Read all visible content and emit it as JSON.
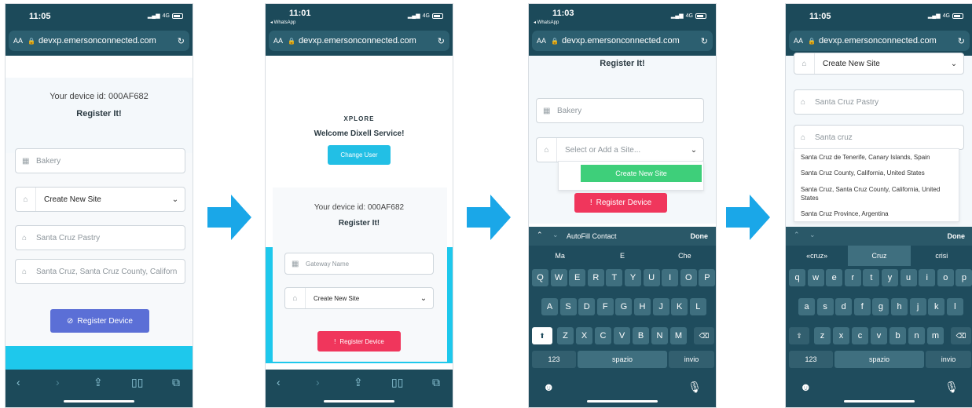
{
  "arrow_color": "#1aa7e8",
  "phones": [
    {
      "status_time": "11:05",
      "status_back": "",
      "signal": "4G",
      "url_aa": "AA",
      "url": "devxp.emersonconnected.com",
      "device_id": "Your device id: 000AF682",
      "register_it": "Register It!",
      "gateway_value": "Bakery",
      "site_select": "Create New Site",
      "site_name_value": "Santa Cruz Pastry",
      "address_value": "Santa Cruz, Santa Cruz County, Californ",
      "register_button": "Register Device",
      "register_color": "#5b6fd6"
    },
    {
      "status_time": "11:01",
      "status_back": "◂ WhatsApp",
      "signal": "4G",
      "url_aa": "AA",
      "url": "devxp.emersonconnected.com",
      "brand": "XPLORE",
      "welcome": "Welcome Dixell Service!",
      "change_user": "Change User",
      "device_id": "Your device id: 000AF682",
      "register_it": "Register It!",
      "gateway_placeholder": "Gateway Name",
      "site_select": "Create New Site",
      "register_button": "Register Device",
      "register_color": "#f0365c"
    },
    {
      "status_time": "11:03",
      "status_back": "◂ WhatsApp",
      "signal": "4G",
      "url_aa": "AA",
      "url": "devxp.emersonconnected.com",
      "register_it": "Register It!",
      "gateway_value": "Bakery",
      "site_placeholder": "Select or Add a Site...",
      "create_new_site": "Create New Site",
      "register_button": "Register Device",
      "register_color": "#f0365c",
      "accessory_label": "AutoFill Contact",
      "done": "Done",
      "predictions": [
        "Ma",
        "E",
        "Che"
      ],
      "row1": [
        "Q",
        "W",
        "E",
        "R",
        "T",
        "Y",
        "U",
        "I",
        "O",
        "P"
      ],
      "row2": [
        "A",
        "S",
        "D",
        "F",
        "G",
        "H",
        "J",
        "K",
        "L"
      ],
      "row3": [
        "Z",
        "X",
        "C",
        "V",
        "B",
        "N",
        "M"
      ],
      "num_key": "123",
      "space_key": "spazio",
      "return_key": "invio"
    },
    {
      "status_time": "11:05",
      "status_back": "",
      "signal": "4G",
      "url_aa": "AA",
      "url": "devxp.emersonconnected.com",
      "site_select": "Create New Site",
      "site_name_value": "Santa Cruz Pastry",
      "address_typed": "Santa cruz",
      "suggestions": [
        "Santa Cruz de Tenerife, Canary Islands, Spain",
        "Santa Cruz County, California, United States",
        "Santa Cruz, Santa Cruz County, California, United States",
        "Santa Cruz Province, Argentina"
      ],
      "done": "Done",
      "predictions": [
        "«cruz»",
        "Cruz",
        "crisi"
      ],
      "row1": [
        "q",
        "w",
        "e",
        "r",
        "t",
        "y",
        "u",
        "i",
        "o",
        "p"
      ],
      "row2": [
        "a",
        "s",
        "d",
        "f",
        "g",
        "h",
        "j",
        "k",
        "l"
      ],
      "row3": [
        "z",
        "x",
        "c",
        "v",
        "b",
        "n",
        "m"
      ],
      "num_key": "123",
      "space_key": "spazio",
      "return_key": "invio"
    }
  ]
}
